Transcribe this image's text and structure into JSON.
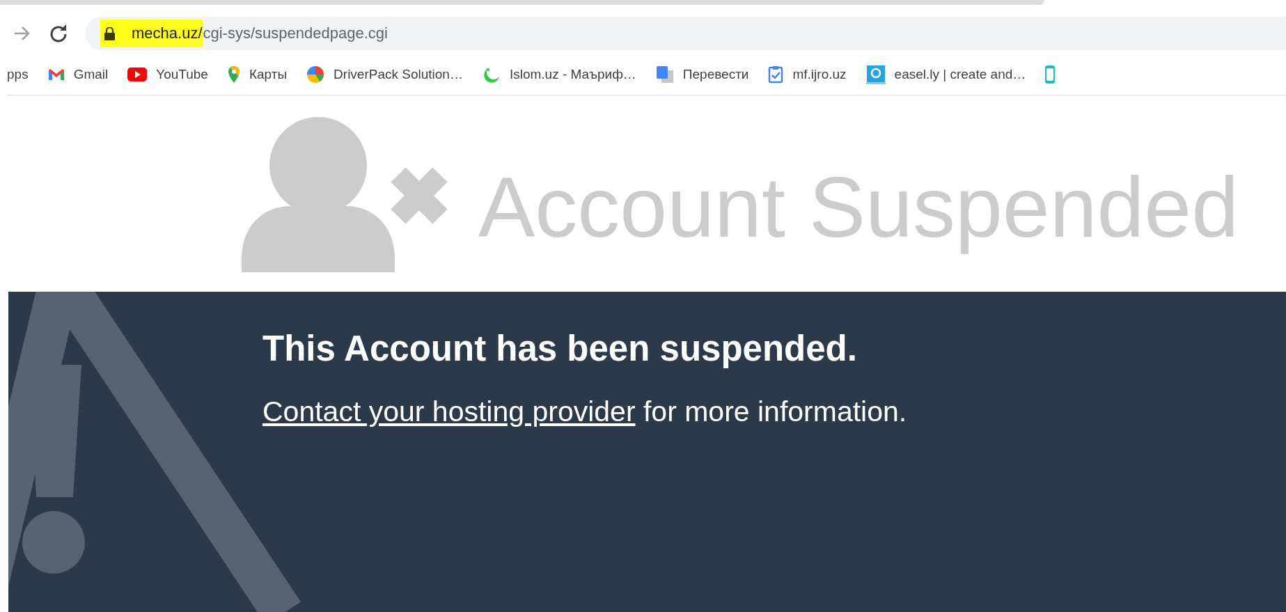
{
  "address_bar": {
    "domain": "mecha.uz/",
    "path": "cgi-sys/suspendedpage.cgi",
    "highlighted": true
  },
  "bookmarks": [
    {
      "label": "pps",
      "kind": "apps"
    },
    {
      "label": "Gmail",
      "kind": "gmail"
    },
    {
      "label": "YouTube",
      "kind": "youtube"
    },
    {
      "label": "Карты",
      "kind": "maps"
    },
    {
      "label": "DriverPack Solution…",
      "kind": "driverpack"
    },
    {
      "label": "Islom.uz - Маъриф…",
      "kind": "crescent"
    },
    {
      "label": "Перевести",
      "kind": "translate"
    },
    {
      "label": "mf.ijro.uz",
      "kind": "clipboard"
    },
    {
      "label": "easel.ly | create and…",
      "kind": "easel"
    },
    {
      "kind": "partial"
    }
  ],
  "banner": {
    "title": "Account Suspended"
  },
  "notice": {
    "heading": "This Account has been suspended.",
    "link": "Contact your hosting provider",
    "text": " for more information."
  }
}
